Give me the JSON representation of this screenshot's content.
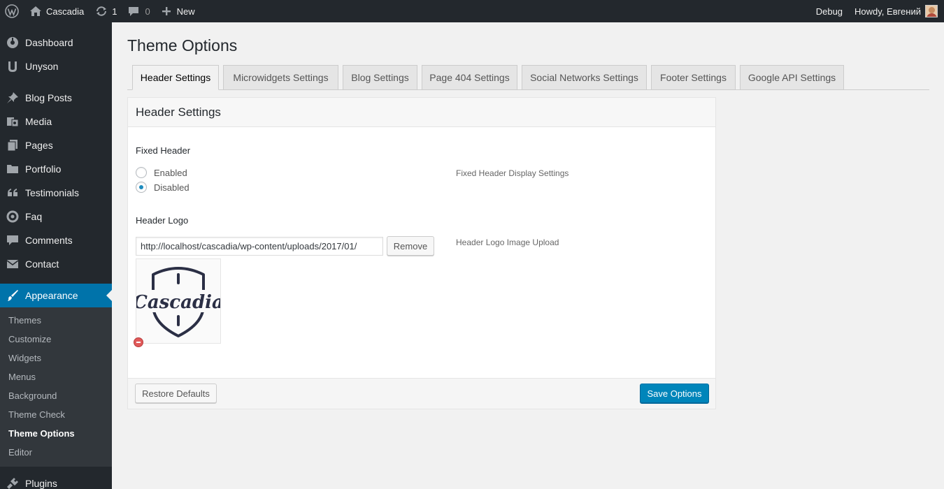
{
  "adminbar": {
    "site_name": "Cascadia",
    "updates_count": "1",
    "comments_count": "0",
    "new_label": "New",
    "debug_label": "Debug",
    "howdy_label": "Howdy, Евгений"
  },
  "sidebar": {
    "items": [
      {
        "label": "Dashboard",
        "icon": "dashboard-icon"
      },
      {
        "label": "Unyson",
        "icon": "unyson-icon"
      },
      {
        "label": "Blog Posts",
        "icon": "pin-icon"
      },
      {
        "label": "Media",
        "icon": "media-icon"
      },
      {
        "label": "Pages",
        "icon": "pages-icon"
      },
      {
        "label": "Portfolio",
        "icon": "folder-icon"
      },
      {
        "label": "Testimonials",
        "icon": "quote-icon"
      },
      {
        "label": "Faq",
        "icon": "lifebuoy-icon"
      },
      {
        "label": "Comments",
        "icon": "comment-icon"
      },
      {
        "label": "Contact",
        "icon": "mail-icon"
      },
      {
        "label": "Appearance",
        "icon": "brush-icon"
      },
      {
        "label": "Plugins",
        "icon": "plug-icon"
      }
    ],
    "submenu": [
      "Themes",
      "Customize",
      "Widgets",
      "Menus",
      "Background",
      "Theme Check",
      "Theme Options",
      "Editor"
    ]
  },
  "main": {
    "page_title": "Theme Options",
    "tabs": [
      "Header Settings",
      "Microwidgets Settings",
      "Blog Settings",
      "Page 404 Settings",
      "Social Networks Settings",
      "Footer Settings",
      "Google API Settings"
    ],
    "active_tab": "Header Settings"
  },
  "panel": {
    "heading": "Header Settings",
    "fixed_header": {
      "title": "Fixed Header",
      "options": [
        "Enabled",
        "Disabled"
      ],
      "selected": "Disabled",
      "description": "Fixed Header Display Settings"
    },
    "header_logo": {
      "title": "Header Logo",
      "url_value": "http://localhost/cascadia/wp-content/uploads/2017/01/",
      "remove_label": "Remove",
      "description": "Header Logo Image Upload",
      "logo_text": "Cascadia"
    },
    "restore_label": "Restore Defaults",
    "save_label": "Save Options"
  },
  "colors": {
    "adminbar_bg": "#23282d",
    "accent": "#0073aa",
    "primary_button": "#0085ba"
  }
}
